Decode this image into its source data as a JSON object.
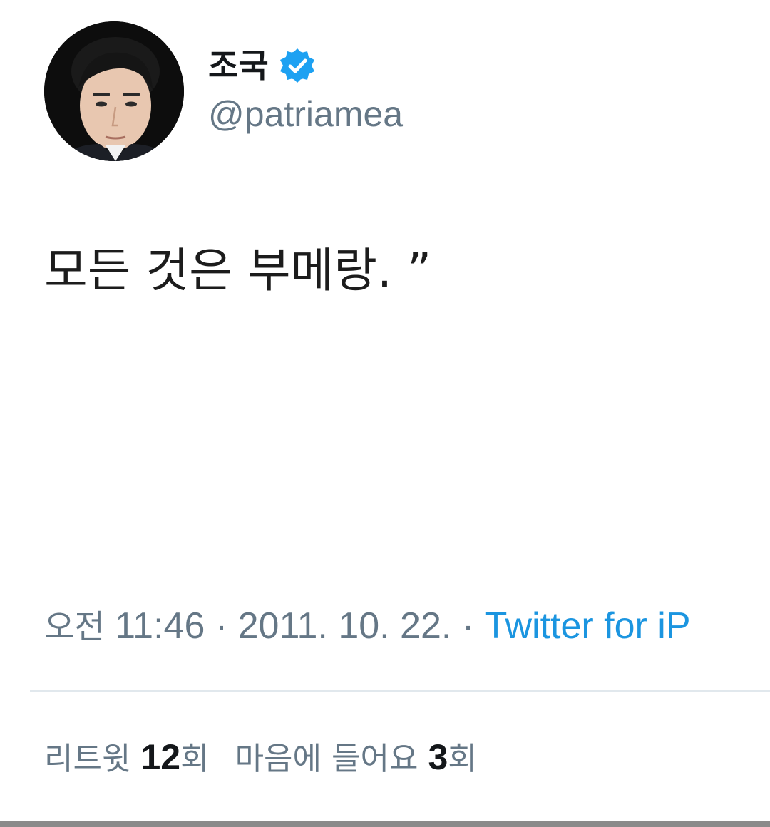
{
  "user": {
    "display_name": "조국",
    "handle": "@patriamea",
    "avatar_icon": "profile-photo",
    "verified_icon": "verified-badge-icon",
    "verified_color": "#1da1f2"
  },
  "tweet": {
    "text": "모든 것은 부메랑. ”"
  },
  "meta": {
    "time_prefix": "오전",
    "time": "11:46",
    "separator": "·",
    "date": "2011. 10. 22.",
    "source": "Twitter for iP"
  },
  "stats": {
    "retweet_label": "리트윗",
    "retweet_count": "12",
    "retweet_unit": "회",
    "like_label": "마음에 들어요",
    "like_count": "3",
    "like_unit": "회"
  },
  "colors": {
    "text_primary": "#14171a",
    "text_secondary": "#657786",
    "link": "#1b95e0",
    "divider": "#e1e8ed"
  }
}
